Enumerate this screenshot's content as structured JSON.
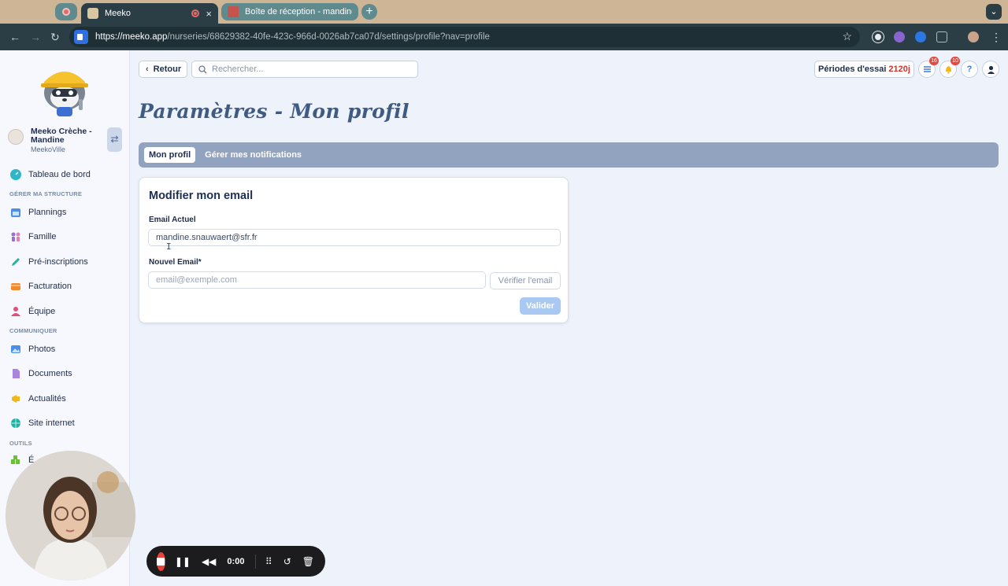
{
  "browser": {
    "tabs": [
      {
        "title": "Meeko",
        "close": "×"
      },
      {
        "title": "Boîte de réception - mandine.",
        "close": ""
      }
    ],
    "new_tab": "+",
    "url_host": "https://meeko.app",
    "url_path": "/nurseries/68629382-40fe-423c-966d-0026ab7ca07d/settings/profile?nav=profile"
  },
  "sidebar": {
    "org_name": "Meeko Crèche - Mandine",
    "org_city": "MeekoVille",
    "dashboard": "Tableau de bord",
    "sections": {
      "manage": "GÉRER MA STRUCTURE",
      "communicate": "COMMUNIQUER",
      "tools": "OUTILS"
    },
    "manage_items": [
      "Plannings",
      "Famille",
      "Pré-inscriptions",
      "Facturation",
      "Équipe"
    ],
    "communicate_items": [
      "Photos",
      "Documents",
      "Actualités",
      "Site internet"
    ],
    "tools_items": [
      "É"
    ]
  },
  "header": {
    "back_label": "Retour",
    "search_placeholder": "Rechercher...",
    "trial_label": "Périodes d'essai",
    "trial_days": "2120j",
    "tasks_badge": "16",
    "notif_badge": "10",
    "help": "?"
  },
  "page": {
    "title": "Paramètres - Mon profil",
    "tabs": [
      "Mon profil",
      "Gérer mes notifications"
    ]
  },
  "email_card": {
    "title": "Modifier mon email",
    "current_label": "Email Actuel",
    "current_value": "mandine.snauwaert@sfr.fr",
    "new_label": "Nouvel Email*",
    "new_placeholder": "email@exemple.com",
    "verify_label": "Vérifier l'email",
    "submit_label": "Valider"
  },
  "recorder": {
    "time": "0:00"
  },
  "colors": {
    "accent": "#a9c8f2",
    "tabs_bar": "#92a3c0",
    "trial_days": "#d0342c",
    "record": "#e8423a"
  }
}
